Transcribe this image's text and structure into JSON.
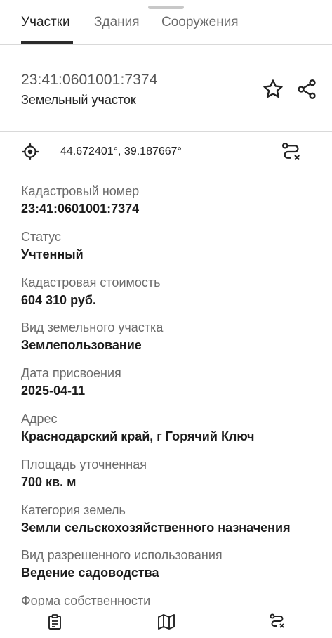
{
  "tabs": [
    {
      "label": "Участки",
      "active": true
    },
    {
      "label": "Здания",
      "active": false
    },
    {
      "label": "Сооружения",
      "active": false
    }
  ],
  "header": {
    "cadastral_number": "23:41:0601001:7374",
    "object_type": "Земельный участок",
    "favorite_icon": "star-icon",
    "share_icon": "share-icon"
  },
  "location": {
    "icon": "locate-icon",
    "coordinates": "44.672401°, 39.187667°",
    "route_icon": "route-cancel-icon"
  },
  "details": [
    {
      "label": "Кадастровый номер",
      "value": "23:41:0601001:7374"
    },
    {
      "label": "Статус",
      "value": "Учтенный"
    },
    {
      "label": "Кадастровая стоимость",
      "value": "604 310 руб."
    },
    {
      "label": "Вид земельного участка",
      "value": "Землепользование"
    },
    {
      "label": "Дата присвоения",
      "value": "2025-04-11"
    },
    {
      "label": "Адрес",
      "value": "Краснодарский край, г Горячий Ключ"
    },
    {
      "label": "Площадь уточненная",
      "value": "700 кв. м"
    },
    {
      "label": "Категория земель",
      "value": "Земли сельскохозяйственного назначения"
    },
    {
      "label": "Вид разрешенного использования",
      "value": "Ведение садоводства"
    },
    {
      "label": "Форма собственности",
      "value": ""
    }
  ],
  "bottom_nav": [
    "clipboard-icon",
    "map-icon",
    "route-cancel-icon"
  ],
  "colors": {
    "text": "#1f1f1f",
    "muted": "#6b6b6b",
    "divider": "#d9d9d9",
    "accent": "#2b2b2b"
  }
}
